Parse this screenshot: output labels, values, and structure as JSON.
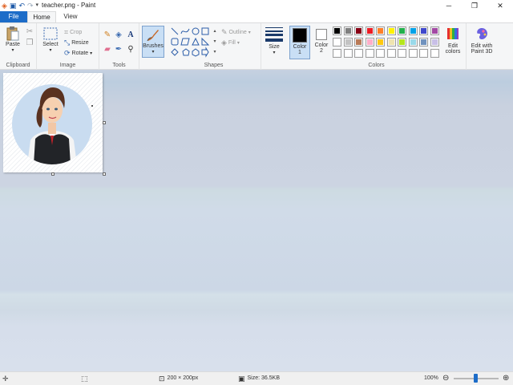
{
  "title_bar": {
    "title": "teacher.png - Paint",
    "quick_access": [
      "paint-app-icon",
      "save-icon",
      "undo-icon",
      "redo-icon",
      "customize-dropdown-icon"
    ],
    "window_controls": [
      "minimize",
      "restore",
      "close"
    ]
  },
  "tabs": [
    {
      "label": "File",
      "active": false
    },
    {
      "label": "Home",
      "active": true
    },
    {
      "label": "View",
      "active": false
    }
  ],
  "ribbon": {
    "clipboard": {
      "label": "Clipboard",
      "paste_label": "Paste"
    },
    "image": {
      "label": "Image",
      "select_label": "Select",
      "crop_label": "Crop",
      "resize_label": "Resize",
      "rotate_label": "Rotate"
    },
    "tools": {
      "label": "Tools"
    },
    "brushes": {
      "label": "Brushes"
    },
    "shapes": {
      "label": "Shapes",
      "outline_label": "Outline",
      "fill_label": "Fill"
    },
    "size": {
      "label": "Size"
    },
    "colors": {
      "label": "Colors",
      "color1_label": "Color",
      "color1_num": "1",
      "color2_label": "Color",
      "color2_num": "2",
      "color1_value": "#000000",
      "color2_value": "#ffffff",
      "edit_colors_line1": "Edit",
      "edit_colors_line2": "colors",
      "paint3d_line1": "Edit with",
      "paint3d_line2": "Paint 3D",
      "palette_row1": [
        "#000000",
        "#7f7f7f",
        "#880015",
        "#ed1c24",
        "#ff7f27",
        "#fff200",
        "#22b14c",
        "#00a2e8",
        "#3f48cc",
        "#a349a4"
      ],
      "palette_row2": [
        "#ffffff",
        "#c3c3c3",
        "#b97a57",
        "#ffaec9",
        "#ffc90e",
        "#efe4b0",
        "#b5e61d",
        "#99d9ea",
        "#7092be",
        "#c8bfe7"
      ],
      "palette_row3": [
        "#ffffff",
        "#ffffff",
        "#ffffff",
        "#ffffff",
        "#ffffff",
        "#ffffff",
        "#ffffff",
        "#ffffff",
        "#ffffff",
        "#ffffff"
      ]
    }
  },
  "status_bar": {
    "dimensions": "200 × 200px",
    "size": "Size: 36.5KB",
    "zoom": "100%"
  }
}
